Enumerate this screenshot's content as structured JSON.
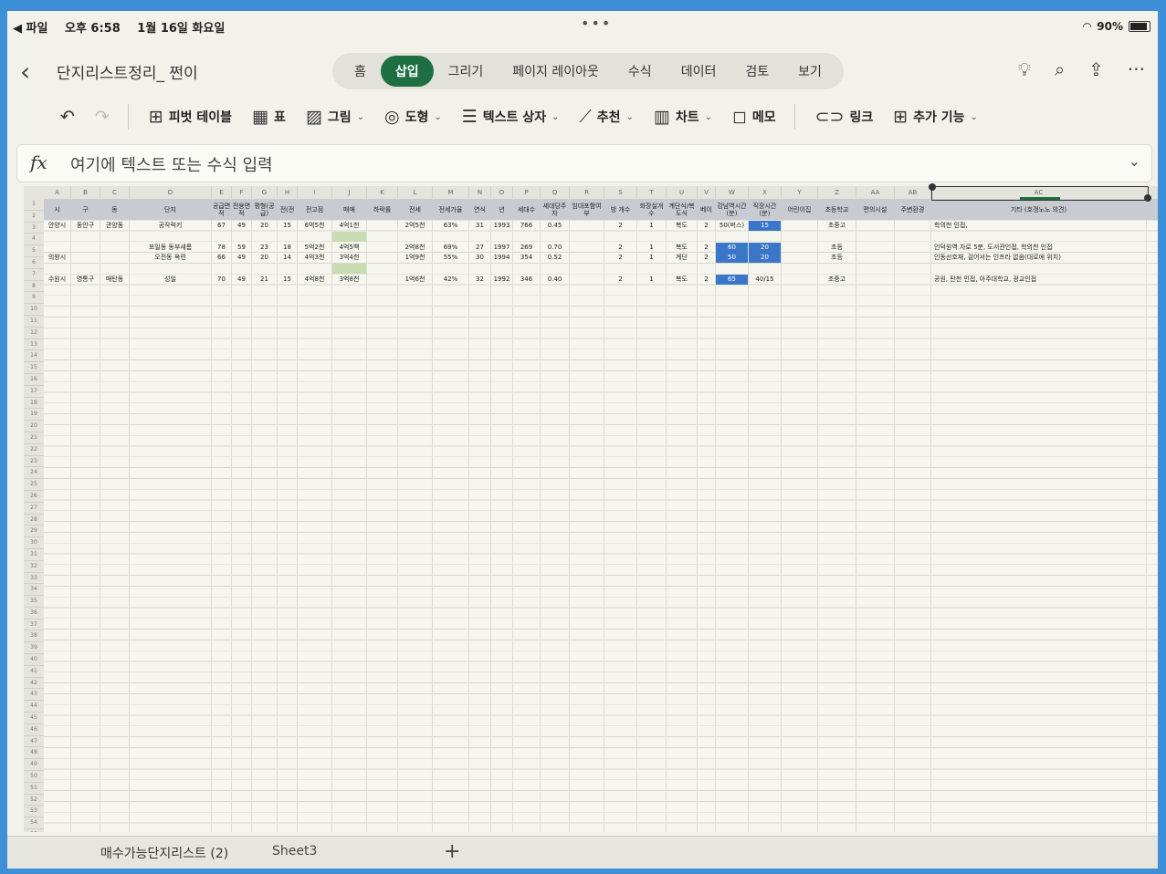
{
  "status": {
    "back_app": "◀ 파일",
    "time": "오후 6:58",
    "date": "1월 16일 화요일",
    "battery": "90%"
  },
  "doc": {
    "title": "단지리스트정리_ 쩐이"
  },
  "ribbon_tabs": [
    "홈",
    "삽입",
    "그리기",
    "페이지 레이아웃",
    "수식",
    "데이터",
    "검토",
    "보기"
  ],
  "active_tab": "삽입",
  "toolbar": {
    "pivot": "피벗 테이블",
    "table": "표",
    "picture": "그림",
    "shapes": "도형",
    "textbox": "텍스트 상자",
    "recommend": "추천",
    "chart": "차트",
    "memo": "메모",
    "link": "링크",
    "addins": "추가 기능"
  },
  "formula": {
    "placeholder": "여기에 텍스트 또는 수식 입력"
  },
  "columns": [
    "A",
    "B",
    "C",
    "D",
    "E",
    "F",
    "G",
    "H",
    "I",
    "J",
    "K",
    "L",
    "M",
    "N",
    "O",
    "P",
    "Q",
    "R",
    "S",
    "T",
    "U",
    "V",
    "W",
    "X",
    "Y",
    "Z",
    "AA",
    "AB",
    "AC"
  ],
  "headers": [
    "시",
    "구",
    "동",
    "단지",
    "공급면적",
    "전용면적",
    "평형(공급)",
    "전(전",
    "전고점",
    "매매",
    "하락률",
    "전세",
    "전세가율",
    "연식",
    "년",
    "세대수",
    "세대당주차",
    "임대포함여부",
    "방 개수",
    "화장실개수",
    "계단식/복도식",
    "베이",
    "강남역시간(분)",
    "직장시간(분)",
    "어린이집",
    "초등학교",
    "편의시설",
    "주변환경",
    "기타 (호갱노노 의견)"
  ],
  "rows": [
    [
      "안양시",
      "동안구",
      "관양동",
      "공작럭키",
      "67",
      "49",
      "20",
      "15",
      "6억5천",
      "4억1천",
      "",
      "2억5천",
      "63%",
      "31",
      "1993",
      "766",
      "0.45",
      "",
      "2",
      "1",
      "복도",
      "2",
      "50(버스)",
      "15",
      "",
      "초중고",
      "",
      "",
      "학의천 인접,"
    ],
    [
      "",
      "",
      "",
      "",
      "",
      "",
      "",
      "",
      "",
      "",
      "",
      "",
      "",
      "",
      "",
      "",
      "",
      "",
      "",
      "",
      "",
      "",
      "",
      "",
      "",
      "",
      "",
      "",
      ""
    ],
    [
      "",
      "",
      "",
      "포일동 동부새롬",
      "78",
      "59",
      "23",
      "18",
      "5억2천",
      "4억5백",
      "",
      "2억8천",
      "69%",
      "27",
      "1997",
      "269",
      "0.70",
      "",
      "2",
      "1",
      "복도",
      "2",
      "60",
      "20",
      "",
      "초등",
      "",
      "",
      "인덕원역 차로 5분, 도서관인접, 학의천 인접"
    ],
    [
      "의왕시",
      "",
      "",
      "오전동 옥련",
      "66",
      "49",
      "20",
      "14",
      "4억3천",
      "3억4천",
      "",
      "1억9천",
      "55%",
      "30",
      "1994",
      "354",
      "0.52",
      "",
      "2",
      "1",
      "계단",
      "2",
      "50",
      "20",
      "",
      "초등",
      "",
      "",
      "인동선호재, 걸어서는 인프라 없음(대로에 위치)"
    ],
    [
      "",
      "",
      "",
      "",
      "",
      "",
      "",
      "",
      "",
      "",
      "",
      "",
      "",
      "",
      "",
      "",
      "",
      "",
      "",
      "",
      "",
      "",
      "",
      "",
      "",
      "",
      "",
      "",
      ""
    ],
    [
      "수원시",
      "영통구",
      "매탄동",
      "성일",
      "70",
      "49",
      "21",
      "15",
      "4억8천",
      "3억8천",
      "",
      "1억6천",
      "42%",
      "32",
      "1992",
      "346",
      "0.40",
      "",
      "2",
      "1",
      "복도",
      "2",
      "65",
      "40/15",
      "",
      "초중고",
      "",
      "",
      "공원, 탄천 인접, 아주대학교, 광교인접"
    ]
  ],
  "sheets": [
    "매수가능단지리스트 (2)",
    "Sheet3"
  ],
  "add_sheet": "+",
  "colors": {
    "accent": "#1d6f42",
    "highlight_blue": "#3b77c8",
    "highlight_green": "#c9dcaf",
    "header_fill": "#c8ccd2",
    "frame": "#3d8fd8"
  }
}
